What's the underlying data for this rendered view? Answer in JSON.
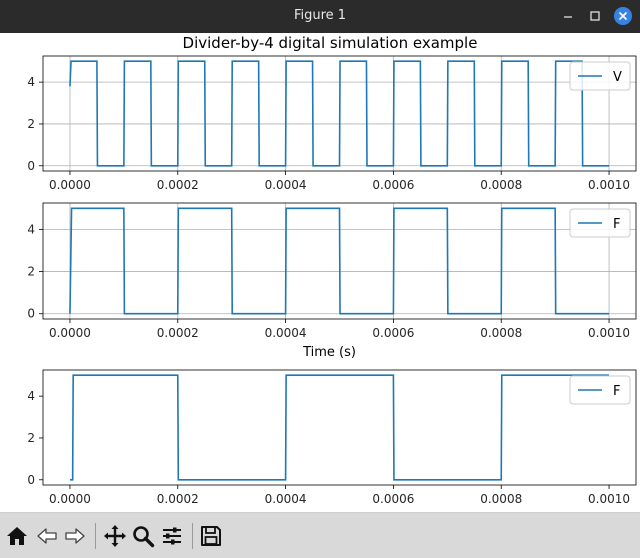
{
  "window": {
    "title": "Figure 1"
  },
  "figure": {
    "title": "Divider-by-4 digital simulation example"
  },
  "colors": {
    "line": "#1f77b4",
    "grid": "#b0b0b0"
  },
  "chart_data": [
    {
      "type": "line",
      "title": "Divider-by-4 digital simulation example",
      "xlabel": "",
      "ylabel": "",
      "xlim": [
        -5e-05,
        0.00105
      ],
      "ylim": [
        -0.25,
        5.25
      ],
      "xticks": [
        "0.0000",
        "0.0002",
        "0.0004",
        "0.0006",
        "0.0008",
        "0.0010"
      ],
      "yticks": [
        "0",
        "2",
        "4"
      ],
      "grid": true,
      "legend": "top-right",
      "series": [
        {
          "name": "V",
          "x": [
            0.0,
            2e-06,
            5e-06,
            5e-05,
            5.1e-05,
            0.0001,
            0.000101,
            0.00015,
            0.000151,
            0.0002,
            0.000201,
            0.00025,
            0.000251,
            0.0003,
            0.000301,
            0.00035,
            0.000351,
            0.0004,
            0.000401,
            0.00045,
            0.000451,
            0.0005,
            0.000501,
            0.00055,
            0.000551,
            0.0006,
            0.000601,
            0.00065,
            0.000651,
            0.0007,
            0.000701,
            0.00075,
            0.000751,
            0.0008,
            0.000801,
            0.00085,
            0.000851,
            0.0009,
            0.000901,
            0.00095,
            0.000951,
            0.001
          ],
          "y": [
            3.8,
            5,
            5,
            5,
            0,
            0,
            5,
            5,
            0,
            0,
            5,
            5,
            0,
            0,
            5,
            5,
            0,
            0,
            5,
            5,
            0,
            0,
            5,
            5,
            0,
            0,
            5,
            5,
            0,
            0,
            5,
            5,
            0,
            0,
            5,
            5,
            0,
            0,
            5,
            5,
            0,
            0
          ]
        }
      ]
    },
    {
      "type": "line",
      "title": "",
      "xlabel": "Time (s)",
      "ylabel": "",
      "xlim": [
        -5e-05,
        0.00105
      ],
      "ylim": [
        -0.25,
        5.25
      ],
      "xticks": [
        "0.0000",
        "0.0002",
        "0.0004",
        "0.0006",
        "0.0008",
        "0.0010"
      ],
      "yticks": [
        "0",
        "2",
        "4"
      ],
      "grid": true,
      "legend": "top-right",
      "series": [
        {
          "name": "F",
          "x": [
            0.0,
            3e-06,
            0.0001,
            0.000101,
            0.0002,
            0.000201,
            0.0003,
            0.000301,
            0.0004,
            0.000401,
            0.0005,
            0.000501,
            0.0006,
            0.000601,
            0.0007,
            0.000701,
            0.0008,
            0.000801,
            0.0009,
            0.000901,
            0.001
          ],
          "y": [
            0,
            5,
            5,
            0,
            0,
            5,
            5,
            0,
            0,
            5,
            5,
            0,
            0,
            5,
            5,
            0,
            0,
            5,
            5,
            0,
            0
          ]
        }
      ]
    },
    {
      "type": "line",
      "title": "",
      "xlabel": "",
      "ylabel": "",
      "xlim": [
        -5e-05,
        0.00105
      ],
      "ylim": [
        -0.25,
        5.25
      ],
      "xticks": [
        "0.0000",
        "0.0002",
        "0.0004",
        "0.0006",
        "0.0008",
        "0.0010"
      ],
      "yticks": [
        "0",
        "2",
        "4"
      ],
      "grid": false,
      "legend": "top-right",
      "series": [
        {
          "name": "F",
          "x": [
            0.0,
            5e-06,
            6e-06,
            0.0002,
            0.000201,
            0.0004,
            0.000401,
            0.0006,
            0.000601,
            0.0008,
            0.000801,
            0.001
          ],
          "y": [
            0,
            0,
            5,
            5,
            0,
            0,
            5,
            5,
            0,
            0,
            5,
            5
          ]
        }
      ]
    }
  ],
  "toolbar": {
    "icons": [
      "home-icon",
      "back-arrow-icon",
      "forward-arrow-icon",
      "pan-icon",
      "zoom-icon",
      "configure-subplots-icon",
      "save-icon"
    ]
  }
}
